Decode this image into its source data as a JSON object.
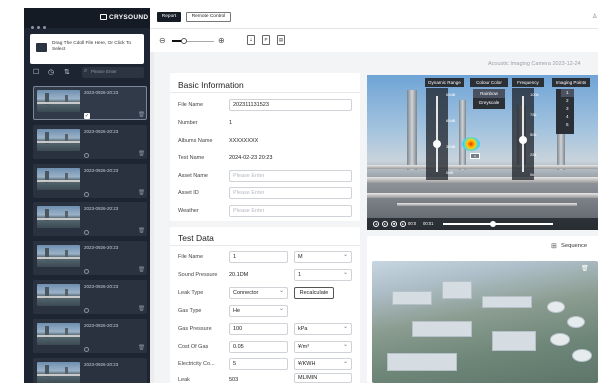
{
  "sidebar": {
    "brand": "CRYSOUND",
    "drop_text": "Drag The Cdoll File Here, Or Click To Select",
    "search_placeholder": "Please Enter",
    "items": [
      {
        "date": "2023-0926-20:23",
        "checked": true
      },
      {
        "date": "2023-0926-20:23",
        "checked": false
      },
      {
        "date": "2023-0926-20:23",
        "checked": false
      },
      {
        "date": "2023-0926-20:23",
        "checked": false
      },
      {
        "date": "2023-0926-20:23",
        "checked": false
      },
      {
        "date": "2023-0926-20:23",
        "checked": false
      },
      {
        "date": "2023-0926-20:23",
        "checked": false
      },
      {
        "date": "2023-0926-20:23",
        "checked": false
      }
    ]
  },
  "toolbar": {
    "report_label": "Report",
    "remote_label": "Remote Control"
  },
  "camera_title": "Acoustic Imaging Camera 2023-12-24",
  "basic_info": {
    "title": "Basic Information",
    "rows": [
      {
        "label": "File Name",
        "value": "202311131523",
        "kind": "input"
      },
      {
        "label": "Number",
        "value": "1",
        "kind": "text"
      },
      {
        "label": "Albums Name",
        "value": "XXXXXXXX",
        "kind": "text"
      },
      {
        "label": "Test Name",
        "value": "2024-02-23 20:23",
        "kind": "text"
      },
      {
        "label": "Asset Name",
        "placeholder": "Please Enter",
        "kind": "input"
      },
      {
        "label": "Asset ID",
        "placeholder": "Please Enter",
        "kind": "input"
      },
      {
        "label": "Weather",
        "placeholder": "Please Enter",
        "kind": "input"
      }
    ]
  },
  "test_data": {
    "title": "Test Data",
    "file_name_label": "File Name",
    "file_name_value": "1",
    "file_name_unit": "M",
    "sound_pressure_label": "Sound Pressure",
    "sound_pressure_value": "20.1DM",
    "sound_pressure_unit": "1",
    "leak_type_label": "Leak Type",
    "leak_type_value": "Connector",
    "recalculate_label": "Recalculate",
    "gas_type_label": "Gas Type",
    "gas_type_value": "He",
    "gas_pressure_label": "Gas Pressure",
    "gas_pressure_value": "100",
    "gas_pressure_unit": "kPa",
    "cost_label": "Cost Of Gas",
    "cost_value": "0.05",
    "cost_unit": "¥/m³",
    "electricity_label": "Electricity Co...",
    "electricity_value": "5",
    "electricity_unit": "¥/KWH",
    "leak_label": "Leak",
    "leak_value": "503",
    "leak_unit": "ML/MIN"
  },
  "thermal": {
    "tabs": [
      "Dynamic Range",
      "Colour Color",
      "Frequency",
      "Imaging Points"
    ],
    "color_options": [
      "Rainbow",
      "Greyscale"
    ],
    "selected_color": "Rainbow",
    "points_options": [
      "1",
      "2",
      "3",
      "4",
      "5"
    ],
    "selected_point": "1",
    "dyn_labels": [
      "60dB",
      "60dB",
      "30dB",
      "0dB"
    ],
    "freq_labels": [
      "100k",
      "75k",
      "50k",
      "25k",
      "0k"
    ],
    "time_current": "00:0",
    "time_total": "00:01"
  },
  "sequence": {
    "label": "Sequence"
  }
}
